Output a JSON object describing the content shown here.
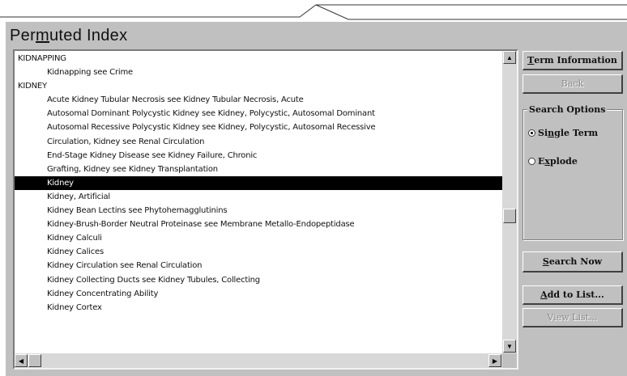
{
  "window": {
    "title_pre": "Per",
    "title_mnemonic": "m",
    "title_post": "uted Index"
  },
  "list": {
    "rows": [
      {
        "text": "KIDNAPPING",
        "indent": false,
        "selected": false
      },
      {
        "text": "Kidnapping see Crime",
        "indent": true,
        "selected": false
      },
      {
        "text": "KIDNEY",
        "indent": false,
        "selected": false
      },
      {
        "text": "Acute Kidney Tubular Necrosis see Kidney Tubular Necrosis, Acute",
        "indent": true,
        "selected": false
      },
      {
        "text": "Autosomal Dominant Polycystic Kidney see Kidney, Polycystic, Autosomal Dominant",
        "indent": true,
        "selected": false
      },
      {
        "text": "Autosomal Recessive Polycystic Kidney see Kidney, Polycystic, Autosomal Recessive",
        "indent": true,
        "selected": false
      },
      {
        "text": "Circulation, Kidney see Renal Circulation",
        "indent": true,
        "selected": false
      },
      {
        "text": "End-Stage Kidney Disease see Kidney Failure, Chronic",
        "indent": true,
        "selected": false
      },
      {
        "text": "Grafting, Kidney see Kidney Transplantation",
        "indent": true,
        "selected": false
      },
      {
        "text": "Kidney",
        "indent": true,
        "selected": true
      },
      {
        "text": "Kidney, Artificial",
        "indent": true,
        "selected": false
      },
      {
        "text": "Kidney Bean Lectins see Phytohemagglutinins",
        "indent": true,
        "selected": false
      },
      {
        "text": "Kidney-Brush-Border Neutral Proteinase see Membrane Metallo-Endopeptidase",
        "indent": true,
        "selected": false
      },
      {
        "text": "Kidney Calculi",
        "indent": true,
        "selected": false
      },
      {
        "text": "Kidney Calices",
        "indent": true,
        "selected": false
      },
      {
        "text": "Kidney Circulation see Renal Circulation",
        "indent": true,
        "selected": false
      },
      {
        "text": "Kidney Collecting Ducts see Kidney Tubules, Collecting",
        "indent": true,
        "selected": false
      },
      {
        "text": "Kidney Concentrating Ability",
        "indent": true,
        "selected": false
      },
      {
        "text": "Kidney Cortex",
        "indent": true,
        "selected": false
      }
    ]
  },
  "buttons": {
    "term_info": {
      "mn": "T",
      "rest": "erm Information"
    },
    "back": {
      "label": "Back"
    },
    "search_now": {
      "mn": "S",
      "rest": "earch Now"
    },
    "add_to_list": {
      "mn": "A",
      "rest": "dd to List..."
    },
    "view_list": {
      "label": "View List..."
    }
  },
  "search_options": {
    "label": "Search Options",
    "single_term": {
      "pre": "Si",
      "mn": "n",
      "post": "gle Term",
      "selected": true
    },
    "explode": {
      "pre": "E",
      "mn": "x",
      "post": "plode",
      "selected": false
    }
  },
  "icons": {
    "scroll_up": "triangle-up",
    "scroll_down": "triangle-down",
    "scroll_left": "triangle-left",
    "scroll_right": "triangle-right"
  }
}
